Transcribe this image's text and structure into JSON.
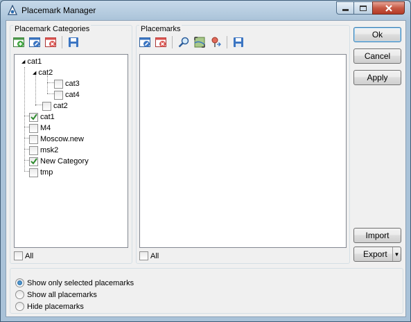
{
  "window": {
    "title": "Placemark Manager"
  },
  "categories": {
    "label": "Placemark Categories",
    "all_label": "All",
    "tree": [
      {
        "label": "cat1",
        "checked": null,
        "expander": "▲"
      },
      {
        "label": "cat2",
        "checked": null,
        "expander": "▲"
      },
      {
        "label": "cat3",
        "checked": false
      },
      {
        "label": "cat4",
        "checked": false
      },
      {
        "label": "cat2",
        "checked": false
      },
      {
        "label": "cat1",
        "checked": true
      },
      {
        "label": "M4",
        "checked": false
      },
      {
        "label": "Moscow.new",
        "checked": false
      },
      {
        "label": "msk2",
        "checked": false
      },
      {
        "label": "New Category",
        "checked": true
      },
      {
        "label": "tmp",
        "checked": false
      }
    ]
  },
  "placemarks": {
    "label": "Placemarks",
    "all_label": "All"
  },
  "buttons": {
    "ok": "Ok",
    "cancel": "Cancel",
    "apply": "Apply",
    "import": "Import",
    "export": "Export"
  },
  "display_options": {
    "show_selected": "Show only selected placemarks",
    "show_all": "Show all placemarks",
    "hide": "Hide placemarks",
    "selected": "show_selected"
  },
  "colors": {
    "accent": "#3c7fb1",
    "check": "#2e8b2e",
    "add_icon": "#3aa33a",
    "remove_icon": "#d9534f"
  }
}
